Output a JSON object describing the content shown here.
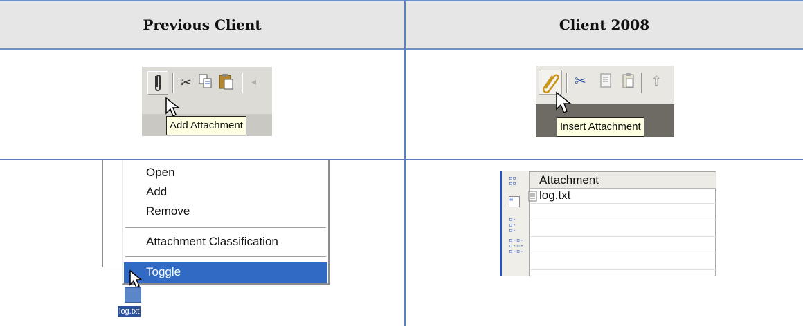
{
  "table": {
    "headers": [
      "Previous Client",
      "Client 2008"
    ]
  },
  "previous_toolbar": {
    "tooltip": "Add Attachment"
  },
  "client2008_toolbar": {
    "tooltip": "Insert Attachment"
  },
  "previous_context_menu": {
    "items": [
      "Open",
      "Add",
      "Remove",
      "Attachment Classification",
      "Toggle"
    ],
    "selected": "Toggle",
    "file_label": "log.txt"
  },
  "client2008_attachments": {
    "column_header": "Attachment",
    "rows": [
      "log.txt"
    ]
  },
  "colors": {
    "rule": "#5b7fc0",
    "header_bg": "#e6e6e6",
    "menu_selection": "#316ac5",
    "tooltip_bg": "#ffffe1"
  }
}
